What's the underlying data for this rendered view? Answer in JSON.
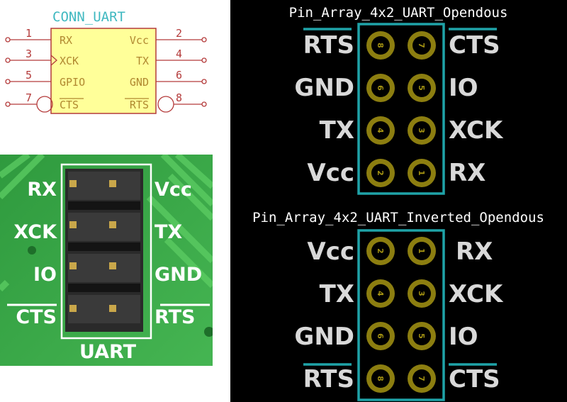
{
  "schematic": {
    "title": "CONN_UART",
    "pins": [
      {
        "num": "1",
        "name": "RX"
      },
      {
        "num": "2",
        "name": "Vcc"
      },
      {
        "num": "3",
        "name": "XCK"
      },
      {
        "num": "4",
        "name": "TX"
      },
      {
        "num": "5",
        "name": "GPIO"
      },
      {
        "num": "6",
        "name": "GND"
      },
      {
        "num": "7",
        "name": "CTS"
      },
      {
        "num": "8",
        "name": "RTS"
      }
    ]
  },
  "photo": {
    "left_labels": [
      "RX",
      "XCK",
      "IO",
      "CTS"
    ],
    "right_labels": [
      "Vcc",
      "TX",
      "GND",
      "RTS"
    ],
    "bottom_label": "UART"
  },
  "footprint_top": {
    "title": "Pin_Array_4x2_UART_Opendous",
    "left_labels": [
      "RTS",
      "GND",
      "TX",
      "Vcc"
    ],
    "right_labels": [
      "CTS",
      "IO",
      "XCK",
      "RX"
    ],
    "left_pads": [
      "8",
      "6",
      "4",
      "2"
    ],
    "right_pads": [
      "7",
      "5",
      "3",
      "1"
    ]
  },
  "footprint_bottom": {
    "title": "Pin_Array_4x2_UART_Inverted_Opendous",
    "left_labels": [
      "Vcc",
      "TX",
      "GND",
      "RTS"
    ],
    "right_labels": [
      "RX",
      "XCK",
      "IO",
      "CTS"
    ],
    "left_pads": [
      "2",
      "4",
      "6",
      "8"
    ],
    "right_pads": [
      "1",
      "3",
      "5",
      "7"
    ]
  },
  "colors": {
    "outline": "#1fa3a8",
    "pad": "#8c7e10",
    "label": "#d9d9d9",
    "board": "#3aa84a",
    "schematic_body": "#ffff99"
  }
}
